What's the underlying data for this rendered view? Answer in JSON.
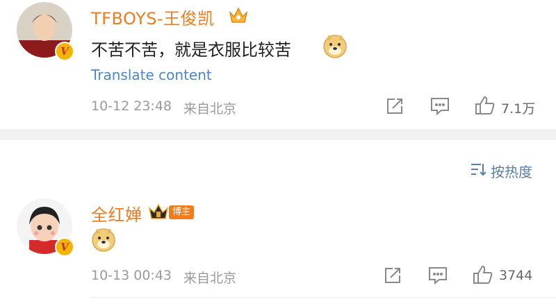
{
  "comments": [
    {
      "username": "TFBOYS-王俊凯",
      "text": "不苦不苦，就是衣服比较苦",
      "translate": "Translate content",
      "timestamp": "10-12 23:48",
      "location": "来自北京",
      "likes": "7.1万"
    },
    {
      "username": "全红婵",
      "badge": "博主",
      "timestamp": "10-13 00:43",
      "location": "来自北京",
      "likes": "3744"
    }
  ],
  "sort": {
    "label": "按热度"
  },
  "colors": {
    "username": "#f07c1c",
    "translate": "#4d87c7",
    "meta": "#9a9a9a"
  },
  "icons": [
    "share-icon",
    "comment-icon",
    "like-icon",
    "doge-emoji",
    "crown-icon",
    "sort-icon"
  ]
}
